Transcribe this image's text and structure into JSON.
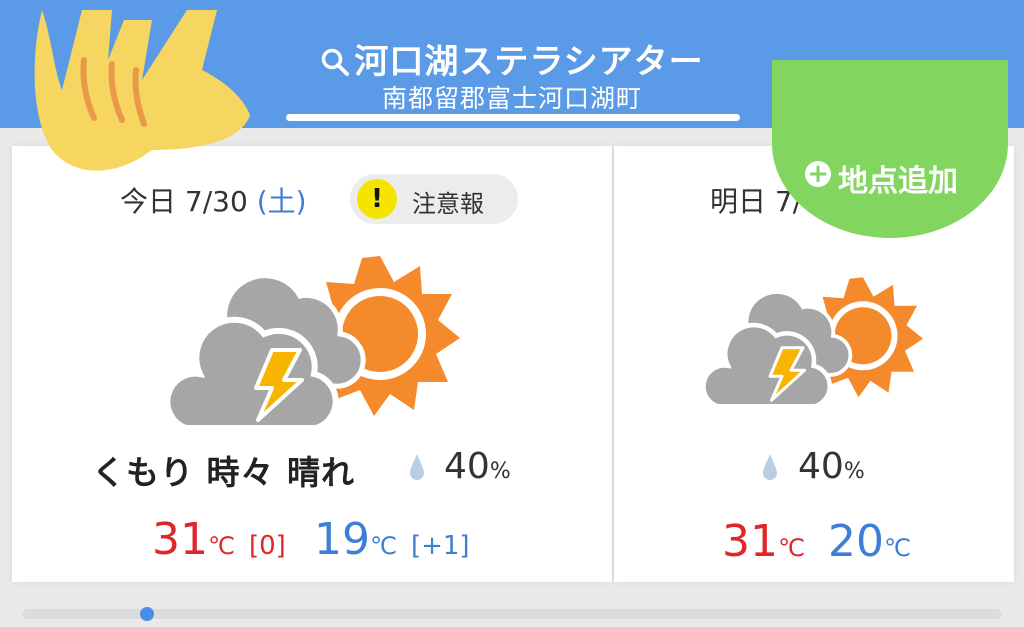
{
  "header": {
    "title": "河口湖ステラシアター",
    "subtitle": "南都留郡富士河口湖町"
  },
  "add_location": {
    "label": "地点追加"
  },
  "today": {
    "date_prefix": "今日 7/30 ",
    "dow": "(土)",
    "warning": "注意報",
    "weather": "くもり 時々 晴れ",
    "pop": "40",
    "pop_unit": "%",
    "high": "31",
    "high_unit": "℃",
    "high_diff": "[0]",
    "low": "19",
    "low_unit": "℃",
    "low_diff": "[+1]"
  },
  "tomorrow": {
    "date_prefix": "明日 7/",
    "pop": "40",
    "pop_unit": "%",
    "high": "31",
    "high_unit": "℃",
    "low": "20",
    "low_unit": "℃"
  },
  "colors": {
    "header": "#5a9ae6",
    "high": "#e0262a",
    "low": "#3d7fd6",
    "add_button": "#82d65f",
    "sun": "#f58a2c",
    "cloud": "#a6a6a6",
    "lightning": "#f7b500",
    "warning": "#f5e400"
  },
  "icons": {
    "weather_today": "cloud-thunder-sun-icon",
    "weather_tomorrow": "cloud-thunder-sun-icon",
    "search": "search-icon",
    "rain_drop": "raindrop-icon",
    "add": "plus-circle-icon",
    "warning": "exclamation-icon"
  }
}
